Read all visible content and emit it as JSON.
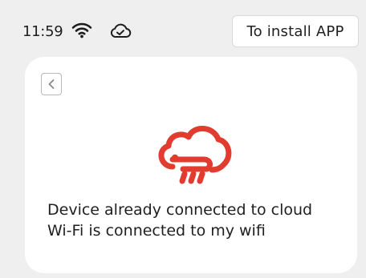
{
  "status_bar": {
    "time": "11:59",
    "wifi_icon": "wifi-icon",
    "cloud_icon": "cloud-check-icon"
  },
  "header": {
    "install_label": "To install APP"
  },
  "card": {
    "back_icon": "chevron-left-icon",
    "logo_icon": "cloud-device-icon",
    "line1": "Device already connected to cloud",
    "line2": "Wi-Fi is connected to my wifi"
  },
  "colors": {
    "accent": "#e23b2f",
    "background": "#efefef",
    "card": "#ffffff"
  }
}
